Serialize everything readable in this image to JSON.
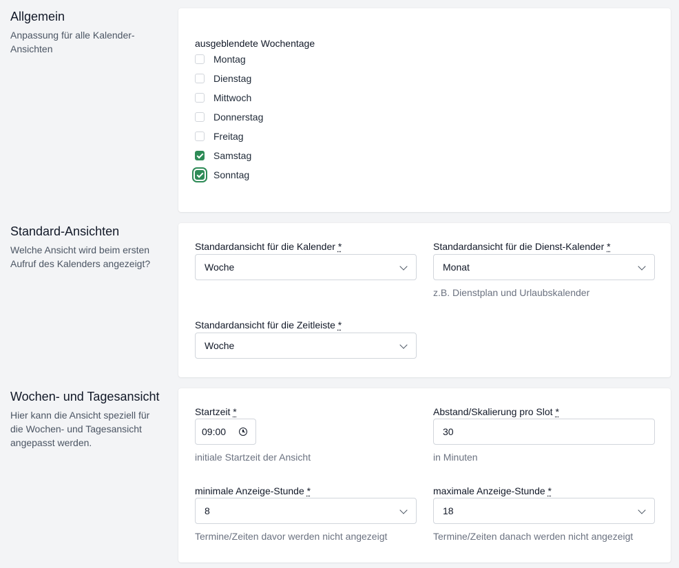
{
  "general": {
    "title": "Allgemein",
    "description": "Anpassung für alle Kalender-Ansichten",
    "hidden_weekdays_label": "ausgeblendete Wochentage",
    "weekdays": [
      {
        "label": "Montag",
        "checked": false
      },
      {
        "label": "Dienstag",
        "checked": false
      },
      {
        "label": "Mittwoch",
        "checked": false
      },
      {
        "label": "Donnerstag",
        "checked": false
      },
      {
        "label": "Freitag",
        "checked": false
      },
      {
        "label": "Samstag",
        "checked": true
      },
      {
        "label": "Sonntag",
        "checked": true
      }
    ]
  },
  "default_views": {
    "title": "Standard-Ansichten",
    "description": "Welche Ansicht wird beim ersten Aufruf des Kalenders angezeigt?",
    "calendar_label": "Standardansicht für die Kalender",
    "calendar_value": "Woche",
    "service_calendar_label": "Standardansicht für die Dienst-Kalender",
    "service_calendar_value": "Monat",
    "service_calendar_hint": "z.B. Dienstplan und Urlaubskalender",
    "timeline_label": "Standardansicht für die Zeitleiste",
    "timeline_value": "Woche",
    "required_mark": "*"
  },
  "week_day_view": {
    "title": "Wochen- und Tagesansicht",
    "description": "Hier kann die Ansicht speziell für die Wochen- und Tagesansicht angepasst werden.",
    "start_time_label": "Startzeit",
    "start_time_value": "09:00",
    "start_time_hint": "initiale Startzeit der Ansicht",
    "slot_label": "Abstand/Skalierung pro Slot",
    "slot_value": "30",
    "slot_hint": "in Minuten",
    "min_hour_label": "minimale Anzeige-Stunde",
    "min_hour_value": "8",
    "min_hour_hint": "Termine/Zeiten davor werden nicht angezeigt",
    "max_hour_label": "maximale Anzeige-Stunde",
    "max_hour_value": "18",
    "max_hour_hint": "Termine/Zeiten danach werden nicht angezeigt",
    "required_mark": "*"
  }
}
